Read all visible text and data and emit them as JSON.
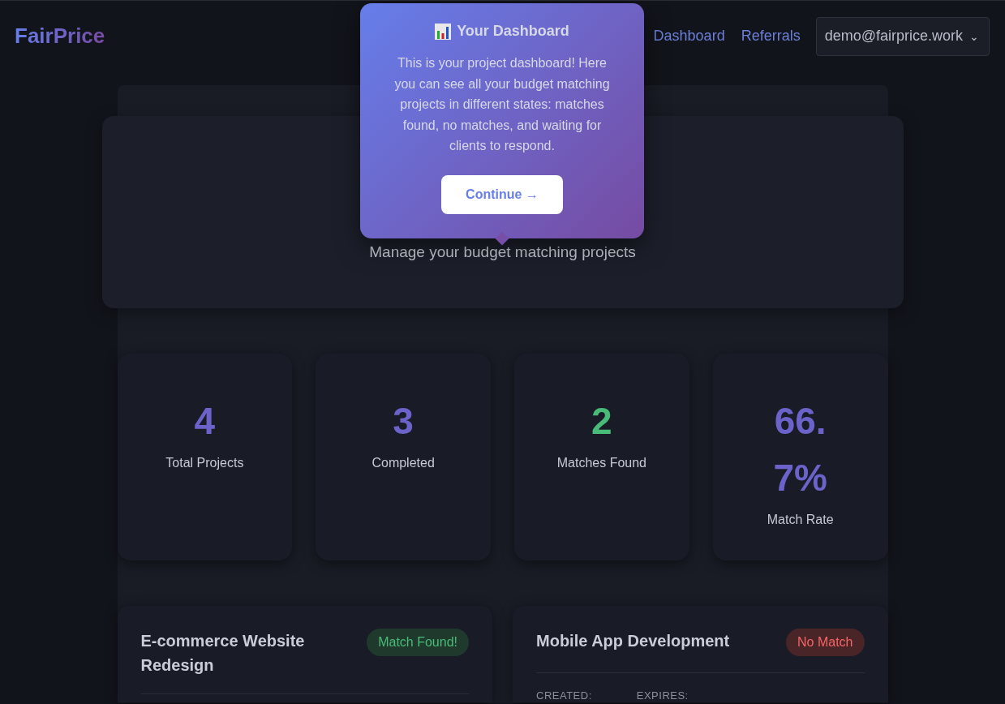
{
  "navbar": {
    "logo": "FairPrice",
    "links": [
      {
        "label": "Dashboard"
      },
      {
        "label": "Referrals"
      }
    ],
    "account": {
      "email": "demo@fairprice.work",
      "caret": "⌄"
    }
  },
  "hero": {
    "subtitle": "Manage your budget matching projects"
  },
  "stats": [
    {
      "value": "4",
      "label": "Total Projects",
      "color": "#6b63c9"
    },
    {
      "value": "3",
      "label": "Completed",
      "color": "#6b63c9"
    },
    {
      "value": "2",
      "label": "Matches Found",
      "color": "#48bb78"
    },
    {
      "value": "66.7%",
      "label": "Match Rate",
      "color": "#6b63c9"
    }
  ],
  "projects": [
    {
      "title": "E-commerce Website Redesign",
      "status": {
        "kind": "match",
        "label": "Match Found!"
      }
    },
    {
      "title": "Mobile App Development",
      "status": {
        "kind": "nomatch",
        "label": "No Match"
      },
      "fields": [
        {
          "label": "CREATED:"
        },
        {
          "label": "EXPIRES:"
        }
      ]
    }
  ],
  "tour_popover": {
    "title": "Your Dashboard",
    "body": "This is your project dashboard! Here you can see all your budget matching projects in different states: matches found, no matches, and waiting for clients to respond.",
    "button": "Continue →"
  }
}
